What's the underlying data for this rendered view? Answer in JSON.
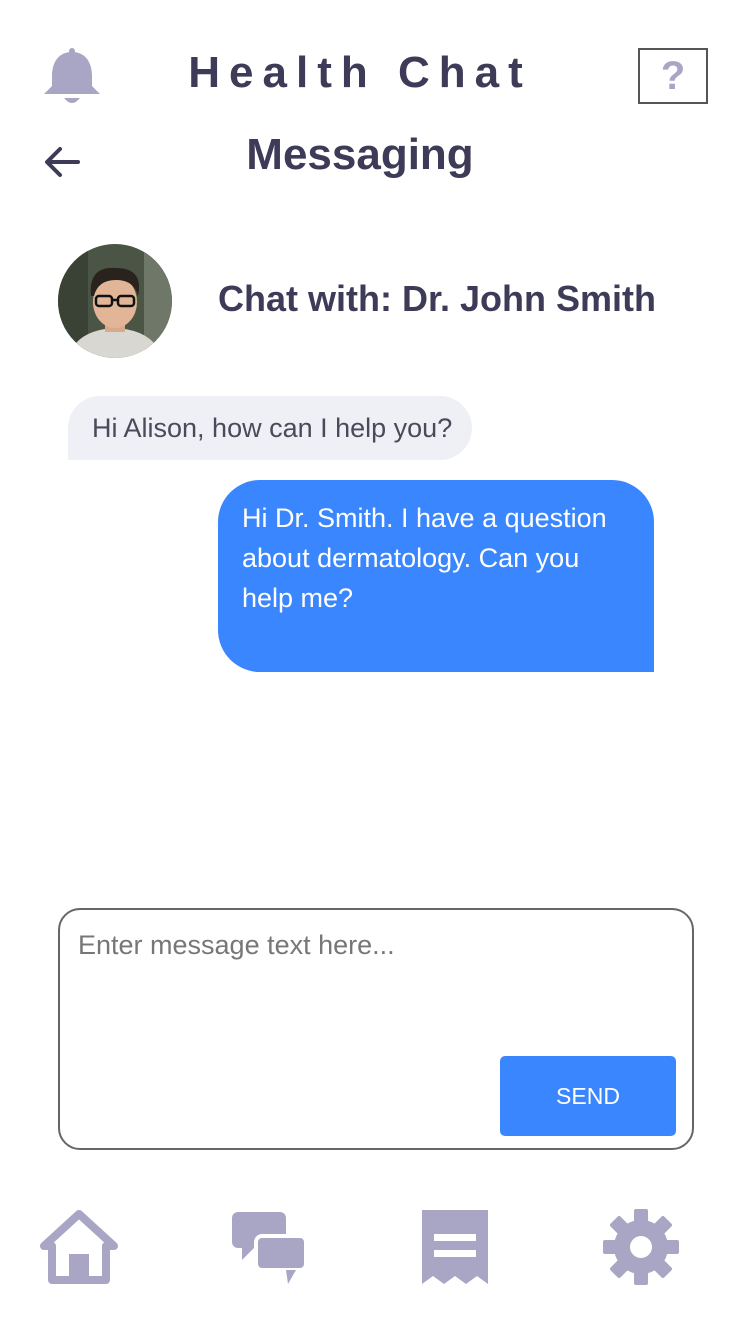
{
  "header": {
    "app_title": "Health Chat",
    "help_label": "?",
    "icons": {
      "left": "bell-icon",
      "back": "arrow-left-icon"
    }
  },
  "page": {
    "title": "Messaging"
  },
  "chat": {
    "with_label": "Chat with: Dr. John Smith",
    "messages": [
      {
        "from": "doctor",
        "text": "Hi Alison, how can I help you?"
      },
      {
        "from": "user",
        "text": "Hi Dr. Smith. I have a question about dermatology. Can you help me?"
      }
    ]
  },
  "composer": {
    "placeholder": "Enter message text here...",
    "value": "",
    "send_label": "SEND"
  },
  "bottom_nav": [
    {
      "icon": "home-icon"
    },
    {
      "icon": "chat-bubbles-icon"
    },
    {
      "icon": "receipt-icon"
    },
    {
      "icon": "gear-icon"
    }
  ],
  "colors": {
    "accent": "#3a86ff",
    "title_text": "#3d3b57",
    "icon_muted": "#a8a6c4",
    "incoming_bubble": "#eef0f5"
  }
}
